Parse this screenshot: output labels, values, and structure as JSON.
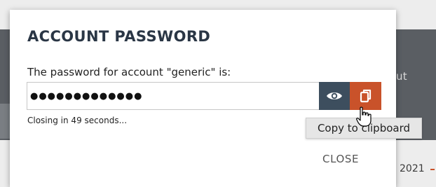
{
  "dialog": {
    "title": "ACCOUNT PASSWORD",
    "prompt": "The password for account \"generic\" is:",
    "password_masked": "●●●●●●●●●●●●●",
    "closing_text": "Closing in 49 seconds...",
    "close_label": "CLOSE"
  },
  "tooltip": {
    "text": "Copy to clipboard"
  },
  "background": {
    "partial_text_right": "ut",
    "partial_year": "2021"
  },
  "icons": {
    "reveal": "eye-icon",
    "copy": "copy-icon",
    "cursor": "hand-pointer-cursor"
  },
  "colors": {
    "title": "#2a3645",
    "reveal_button": "#3d4e5e",
    "copy_button": "#c9522a",
    "tooltip_bg": "#e6e6e6"
  }
}
